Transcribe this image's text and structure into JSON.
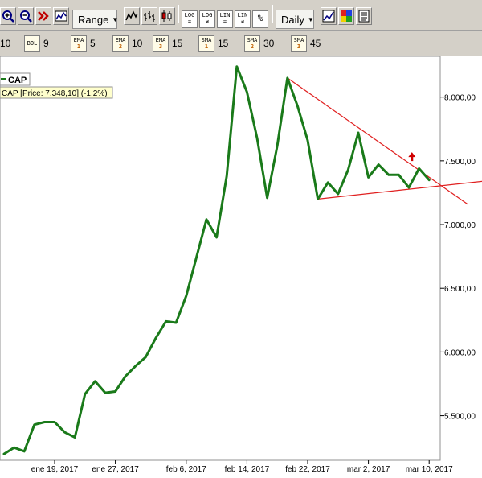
{
  "toolbar": {
    "range_label": "Range",
    "period_label": "Daily",
    "log_buttons": [
      {
        "top": "LOG",
        "bottom": "="
      },
      {
        "top": "LOG",
        "bottom": "≠"
      },
      {
        "top": "LIN",
        "bottom": "="
      },
      {
        "top": "LIN",
        "bottom": "≠"
      },
      {
        "top": "%",
        "bottom": ""
      }
    ]
  },
  "indicators": [
    {
      "top": "",
      "bottom": "",
      "value": "10"
    },
    {
      "top": "BOL",
      "bottom": "",
      "value": "9"
    },
    {
      "top": "EMA",
      "bottom": "1",
      "value": "5"
    },
    {
      "top": "EMA",
      "bottom": "2",
      "value": "10"
    },
    {
      "top": "EMA",
      "bottom": "3",
      "value": "15"
    },
    {
      "top": "SMA",
      "bottom": "1",
      "value": "15"
    },
    {
      "top": "SMA",
      "bottom": "2",
      "value": "30"
    },
    {
      "top": "SMA",
      "bottom": "3",
      "value": "45"
    }
  ],
  "legend": {
    "symbol": "CAP",
    "price_info": "CAP [Price: 7.348,10] (-1,2%)"
  },
  "colors": {
    "series": "#1a7a1a",
    "trendline": "#e02020",
    "arrow": "#d00000",
    "panel": "#d4d0c8"
  },
  "chart_data": {
    "type": "line",
    "title": "",
    "xlabel": "",
    "ylabel": "",
    "ylim": [
      5150,
      8320
    ],
    "yticks": [
      5500,
      6000,
      6500,
      7000,
      7500,
      8000
    ],
    "ytick_labels": [
      "5.500,00",
      "6.000,00",
      "6.500,00",
      "7.000,00",
      "7.500,00",
      "8.000,00"
    ],
    "xticks": [
      {
        "label": "ene 19, 2017",
        "index": 5
      },
      {
        "label": "ene 27, 2017",
        "index": 11
      },
      {
        "label": "feb 6, 2017",
        "index": 18
      },
      {
        "label": "feb 14, 2017",
        "index": 24
      },
      {
        "label": "feb 22, 2017",
        "index": 30
      },
      {
        "label": "mar 2, 2017",
        "index": 36
      },
      {
        "label": "mar 10, 2017",
        "index": 42
      }
    ],
    "series": [
      {
        "name": "CAP",
        "values": [
          5200,
          5250,
          5220,
          5430,
          5450,
          5450,
          5370,
          5330,
          5670,
          5770,
          5680,
          5690,
          5810,
          5890,
          5960,
          6110,
          6240,
          6230,
          6440,
          6740,
          7040,
          6900,
          7380,
          8240,
          8040,
          7680,
          7210,
          7620,
          8150,
          7930,
          7660,
          7200,
          7330,
          7240,
          7430,
          7720,
          7370,
          7470,
          7390,
          7390,
          7290,
          7440,
          7350
        ]
      }
    ],
    "trendlines": [
      {
        "from": [
          28,
          8150
        ],
        "to": [
          45.8,
          7160
        ]
      },
      {
        "from": [
          31,
          7200
        ],
        "to": [
          48.5,
          7350
        ]
      }
    ],
    "marker": {
      "type": "up-arrow",
      "index": 40.3,
      "value": 7530
    }
  }
}
